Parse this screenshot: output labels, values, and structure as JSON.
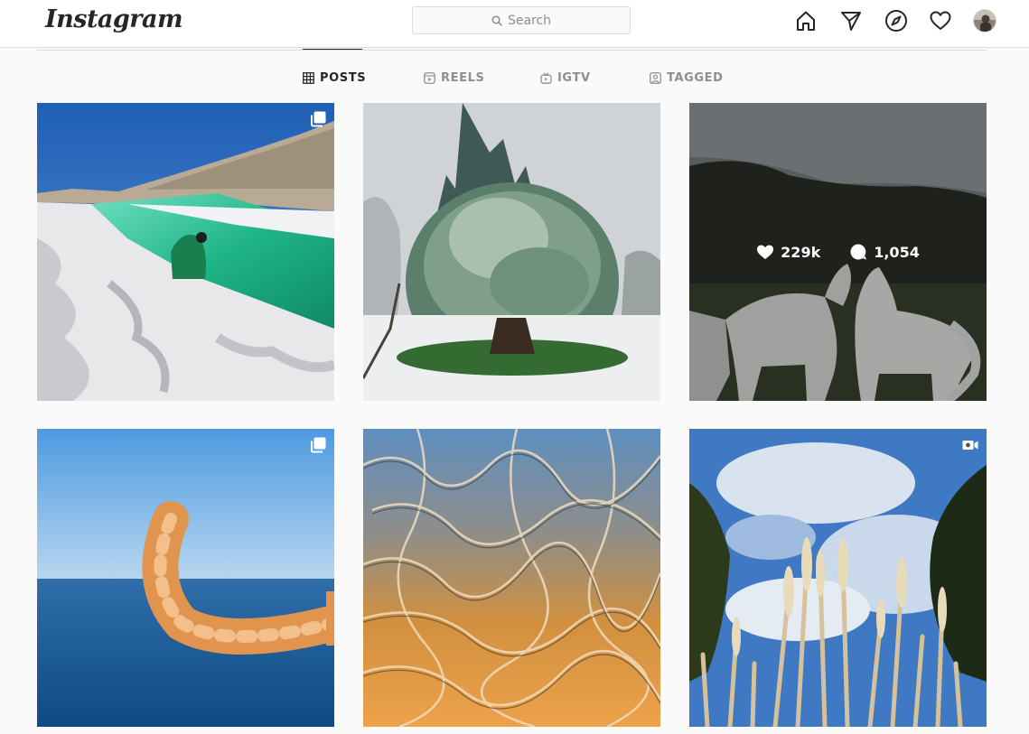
{
  "header": {
    "logo_text": "Instagram",
    "search_placeholder": "Search",
    "icons": [
      "home-icon",
      "direct-message-icon",
      "explore-icon",
      "activity-heart-icon",
      "profile-avatar"
    ]
  },
  "tabs": [
    {
      "label": "POSTS",
      "active": true,
      "icon": "grid-icon"
    },
    {
      "label": "REELS",
      "active": false,
      "icon": "reels-icon"
    },
    {
      "label": "IGTV",
      "active": false,
      "icon": "igtv-icon"
    },
    {
      "label": "TAGGED",
      "active": false,
      "icon": "tagged-icon"
    }
  ],
  "posts": [
    {
      "subject": "salt-flats-turquoise-canal",
      "badge": "carousel-icon"
    },
    {
      "subject": "snow-covered-tree",
      "badge": null
    },
    {
      "subject": "white-horses-at-dusk",
      "badge": null,
      "hover": {
        "likes": "229k",
        "comments": "1,054"
      }
    },
    {
      "subject": "cat-tail-over-ocean",
      "badge": "carousel-icon"
    },
    {
      "subject": "cracked-ice-texture",
      "badge": null
    },
    {
      "subject": "pampas-grass-blue-sky",
      "badge": "video-icon"
    }
  ],
  "colors": {
    "text_primary": "#262626",
    "text_secondary": "#8e8e8e",
    "border": "#dbdbdb",
    "background": "#fafafa"
  }
}
